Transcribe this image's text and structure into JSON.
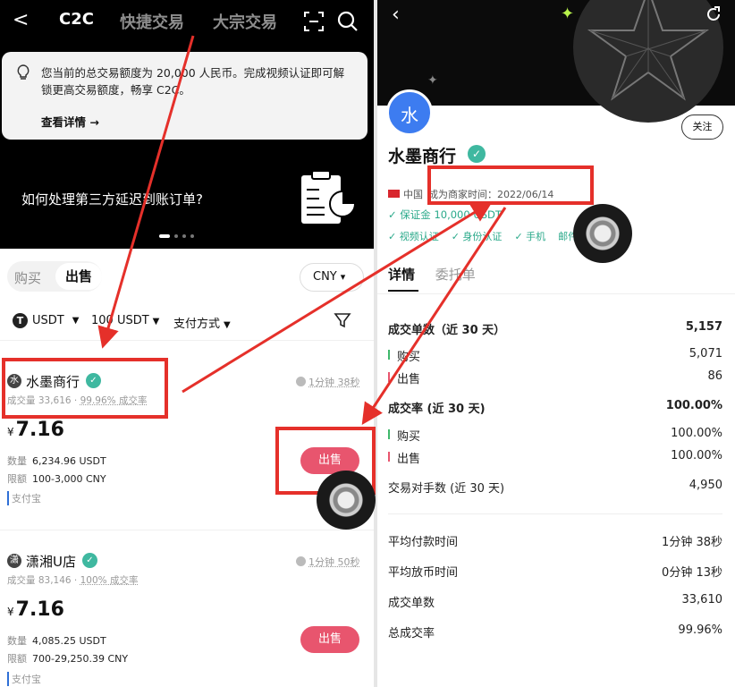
{
  "left": {
    "nav": {
      "back": "<",
      "tabs": [
        "C2C",
        "快捷交易",
        "大宗交易"
      ]
    },
    "notice": {
      "text": "您当前的总交易额度为 20,000 人民币。完成视频认证即可解锁更高交易额度，畅享 C2C。",
      "more": "查看详情 →"
    },
    "banner": {
      "question": "如何处理第三方延迟到账订单?"
    },
    "side_tabs": {
      "buy": "购买",
      "sell": "出售"
    },
    "currency": "CNY",
    "filters": {
      "coin": "USDT",
      "amount": "100 USDT",
      "payment": "支付方式"
    },
    "merchants": [
      {
        "avatar": "水",
        "name": "水墨商行",
        "time": "1分钟 38秒",
        "volume": "成交量 33,616",
        "rate": "99.96% 成交率",
        "price": "7.16",
        "qty_label": "数量",
        "qty": "6,234.96 USDT",
        "limit_label": "限额",
        "limit": "100-3,000 CNY",
        "payment": "支付宝",
        "button": "出售"
      },
      {
        "avatar": "潇",
        "name": "潇湘U店",
        "time": "1分钟 50秒",
        "volume": "成交量 83,146",
        "rate": "100% 成交率",
        "price": "7.16",
        "qty_label": "数量",
        "qty": "4,085.25 USDT",
        "limit_label": "限额",
        "limit": "700-29,250.39 CNY",
        "payment": "支付宝",
        "button": "出售"
      }
    ]
  },
  "right": {
    "avatar": "水",
    "follow": "关注",
    "name": "水墨商行",
    "country": "中国",
    "since": "成为商家时间：2022/06/14",
    "deposit": "✓ 保证金 10,000 USDT",
    "verifications": [
      "✓ 视频认证",
      "✓ 身份认证",
      "✓ 手机",
      "邮件"
    ],
    "tabs": [
      "详情",
      "委托单"
    ],
    "stats": [
      {
        "label": "成交单数（近 30 天）",
        "value": "5,157",
        "kind": "bold"
      },
      {
        "label": "购买",
        "value": "5,071",
        "kind": "buy"
      },
      {
        "label": "出售",
        "value": "86",
        "kind": "sell"
      },
      {
        "label": "成交率 (近 30 天)",
        "value": "100.00%",
        "kind": "bold"
      },
      {
        "label": "购买",
        "value": "100.00%",
        "kind": "buy"
      },
      {
        "label": "出售",
        "value": "100.00%",
        "kind": "sell"
      },
      {
        "label": "交易对手数 (近 30 天)",
        "value": "4,950",
        "kind": "plain"
      },
      {
        "label": "平均付款时间",
        "value": "1分钟 38秒",
        "kind": "plain"
      },
      {
        "label": "平均放币时间",
        "value": "0分钟 13秒",
        "kind": "plain"
      },
      {
        "label": "成交单数",
        "value": "33,610",
        "kind": "plain"
      },
      {
        "label": "总成交率",
        "value": "99.96%",
        "kind": "plain"
      }
    ]
  },
  "colors": {
    "sell_button": "#e8556e",
    "verified": "#2aa98a",
    "annotation": "#e5302a",
    "avatar_blue": "#3d7cf0"
  }
}
